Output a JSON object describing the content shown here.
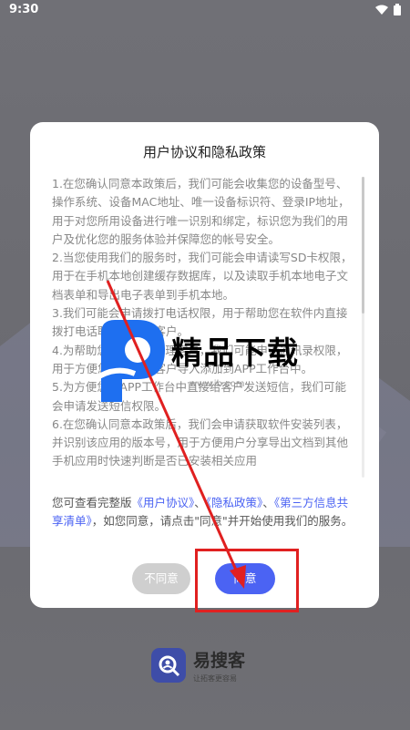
{
  "status": {
    "time": "9:30"
  },
  "dialog": {
    "title": "用户协议和隐私政策",
    "paragraphs": [
      "1.在您确认同意本政策后，我们可能会收集您的设备型号、操作系统、设备MAC地址、唯一设备标识符、登录IP地址，用于对您所用设备进行唯一识别和绑定，标识您为我们的用户及优化您的服务体验并保障您的帐号安全。",
      "2.当您使用我们的服务时，我们可能会申请读写SD卡权限，用于在手机本地创建缓存数据库，以及读取手机本地电子文档表单和导出电子表单到手机本地。",
      "3.我们可能会申请拨打电话权限，用于帮助您在软件内直接拨打电话联系添加的客户。",
      "4.为帮助您更便捷的管理客户，我们可能申请通讯录权限，用于方便您将通讯录客户导入添加到APP工作台中。",
      "5.为方便您在APP工作台中直接给客户发送短信，我们可能会申请发送短信权限。",
      "6.在您确认同意本政策后，我们会申请获取软件安装列表，并识别该应用的版本号，用于方便用户分享导出文档到其他手机应用时快速判断是否已安装相关应用"
    ],
    "notice_prefix": "您可查看完整版",
    "link_user": "《用户协议》",
    "sep1": "、",
    "link_privacy": "《隐私政策》",
    "sep2": "、",
    "link_third": "《第三方信息共享清单》",
    "notice_suffix": "，如您同意，请点击\"同意\"并开始使用我们的服务。",
    "disagree_label": "不同意",
    "agree_label": "同意"
  },
  "watermark": {
    "text": "精品下载",
    "url": "www.jb.com"
  },
  "app": {
    "name": "易搜客",
    "slogan": "让拓客更容易"
  },
  "colors": {
    "accent": "#4b63f3",
    "highlight": "#e02020"
  }
}
